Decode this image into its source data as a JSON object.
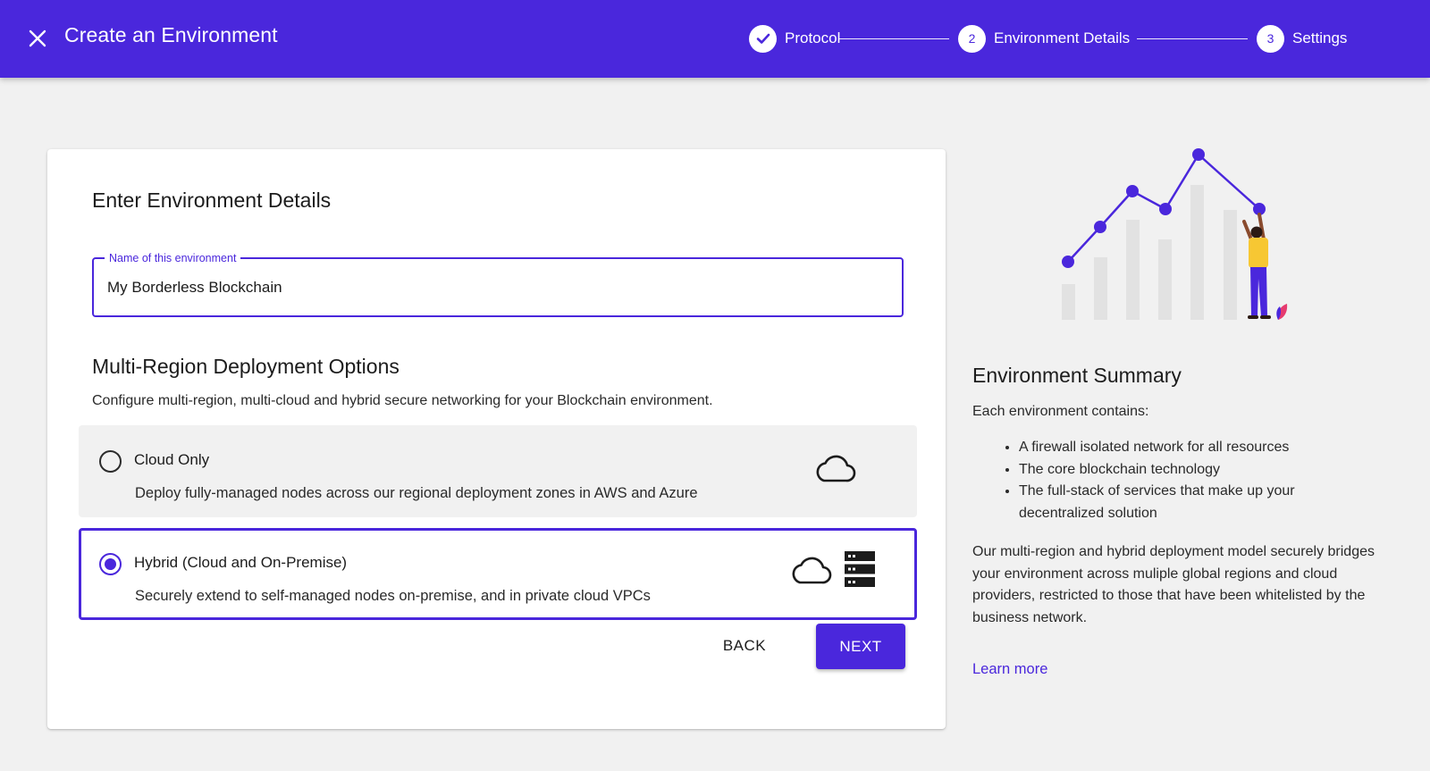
{
  "header": {
    "title": "Create an Environment",
    "close_icon": "close-icon",
    "bar_color": "#4a27dc"
  },
  "stepper": {
    "steps": [
      {
        "number": "",
        "label": "Protocol",
        "status": "completed",
        "icon": "check-icon"
      },
      {
        "number": "2",
        "label": "Environment Details",
        "status": "active"
      },
      {
        "number": "3",
        "label": "Settings",
        "status": "upcoming"
      }
    ]
  },
  "form": {
    "title": "Enter Environment Details",
    "name_field": {
      "label": "Name of this environment",
      "value": "My Borderless Blockchain"
    },
    "deployment": {
      "title": "Multi-Region Deployment Options",
      "description": "Configure multi-region, multi-cloud and hybrid secure networking for your Blockchain environment.",
      "options": [
        {
          "title": "Cloud Only",
          "description": "Deploy fully-managed nodes across our regional deployment zones in AWS and Azure",
          "selected": false,
          "icons": [
            "cloud-icon"
          ]
        },
        {
          "title": "Hybrid (Cloud and On-Premise)",
          "description": "Securely extend to self-managed nodes on-premise, and in private cloud VPCs",
          "selected": true,
          "icons": [
            "cloud-icon",
            "server-icon"
          ]
        }
      ]
    },
    "buttons": {
      "back": "BACK",
      "next": "NEXT"
    }
  },
  "summary": {
    "title": "Environment Summary",
    "intro": "Each environment contains:",
    "items": [
      "A firewall isolated network for all resources",
      "The core blockchain technology",
      "The full-stack of services that make up your decentralized solution"
    ],
    "body": "Our multi-region and hybrid deployment model securely bridges your environment across muliple global regions and cloud providers, restricted to those that have been whitelisted by the business network.",
    "link": "Learn more",
    "illustration": "growth-chart-illustration"
  },
  "colors": {
    "accent": "#4a27dc",
    "background": "#f1f1f1",
    "card": "#ffffff"
  }
}
